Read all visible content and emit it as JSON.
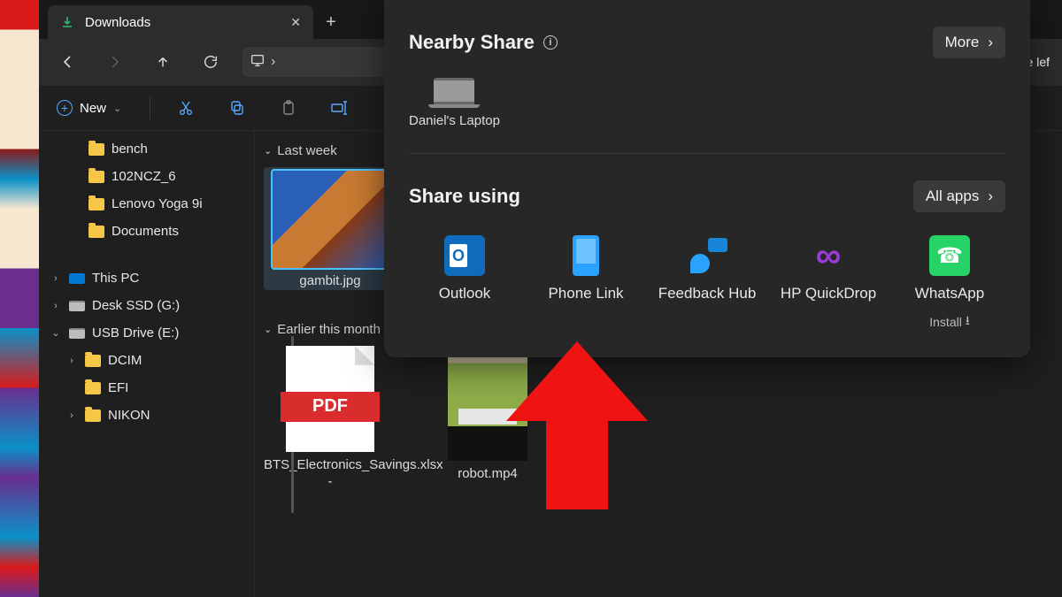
{
  "explorer": {
    "tab_title": "Downloads",
    "addrbar_cut_text": "e lef",
    "new_label": "New",
    "groups": {
      "g1": {
        "label": "Last week",
        "items": {
          "gambit": "gambit.jpg"
        }
      },
      "g2": {
        "label": "Earlier this month",
        "items": {
          "pdf_badge": "PDF",
          "pdf_name": "BTS_Electronics_Savings.xlsx -",
          "robot": "robot.mp4"
        }
      }
    },
    "sidebar": {
      "folders": [
        {
          "name": "bench"
        },
        {
          "name": "102NCZ_6"
        },
        {
          "name": "Lenovo Yoga 9i "
        },
        {
          "name": "Documents"
        }
      ],
      "drives": [
        {
          "name": "This PC",
          "icon": "pc",
          "chev": "›"
        },
        {
          "name": "Desk SSD (G:)",
          "icon": "drive",
          "chev": "›"
        },
        {
          "name": "USB Drive (E:)",
          "icon": "drive",
          "chev": "⌄",
          "children": [
            {
              "name": "DCIM",
              "chev": "›"
            },
            {
              "name": "EFI",
              "chev": ""
            },
            {
              "name": "NIKON",
              "chev": "›"
            }
          ]
        }
      ]
    }
  },
  "share": {
    "nearby_title": "Nearby Share",
    "more_btn": "More",
    "device_name": "Daniel's Laptop",
    "using_title": "Share using",
    "allapps_btn": "All apps",
    "apps": {
      "outlook": "Outlook",
      "phone": "Phone Link",
      "feedback": "Feedback Hub",
      "drop": "HP QuickDrop",
      "whats": "WhatsApp",
      "whats_sub": "Install"
    }
  }
}
